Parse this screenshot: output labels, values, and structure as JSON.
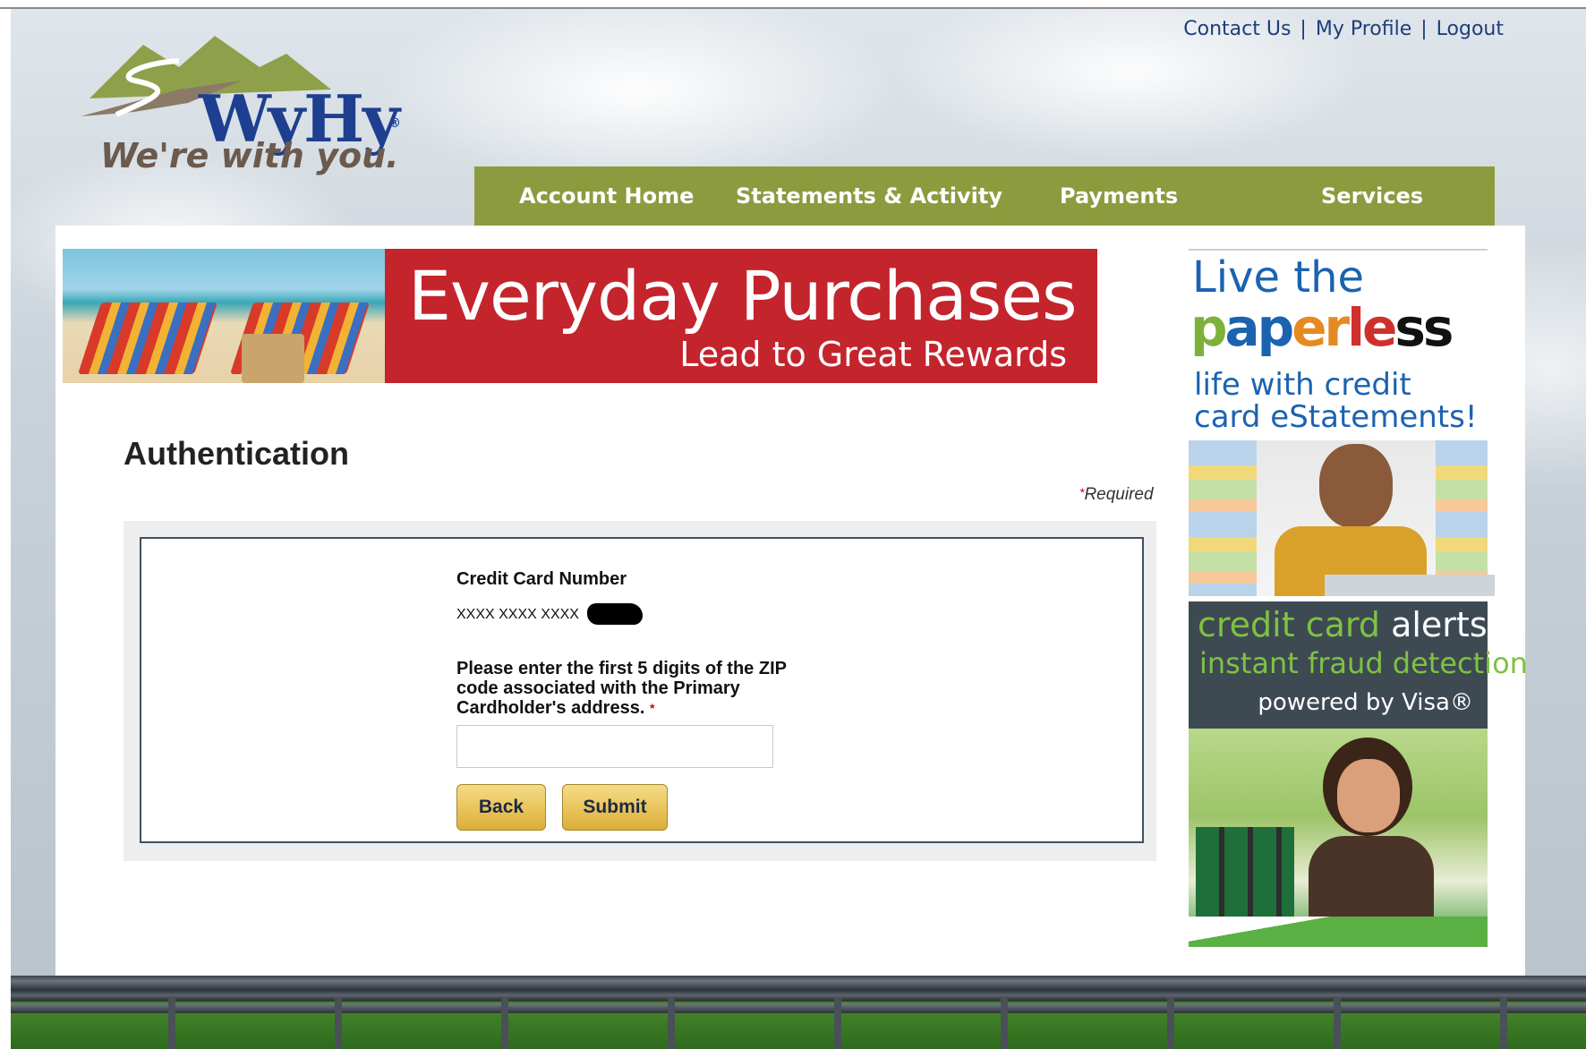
{
  "header": {
    "logo_name": "WyHy",
    "logo_tagline": "We're with you.",
    "util_links": [
      "Contact Us",
      "My Profile",
      "Logout"
    ],
    "separator": "|"
  },
  "nav": {
    "items": [
      "Account Home",
      "Statements & Activity",
      "Payments",
      "Services"
    ]
  },
  "banner": {
    "title": "Everyday Purchases",
    "subtitle": "Lead to Great Rewards"
  },
  "page": {
    "title": "Authentication",
    "required_star": "*",
    "required_label": "Required"
  },
  "form": {
    "card_label": "Credit Card Number",
    "card_masked": "XXXX XXXX XXXX",
    "zip_prompt": "Please enter the first 5 digits of the ZIP code associated with the Primary Cardholder's address.",
    "zip_required_star": "*",
    "zip_value": "",
    "zip_placeholder": "",
    "back_label": "Back",
    "submit_label": "Submit"
  },
  "sidebar": {
    "ad1": {
      "line1": "Live the",
      "paperless_parts": [
        "p",
        "ap",
        "er",
        "le",
        "ss"
      ],
      "line3a": "life with credit",
      "line3b": "card eStatements!"
    },
    "ad2": {
      "line1_green": "credit card",
      "line1_white": "alerts",
      "line2": "instant fraud detection",
      "line3": "powered by Visa®"
    }
  },
  "colors": {
    "nav_bg": "#8d9b3f",
    "banner_red": "#c4242c",
    "link_blue": "#1d3e7a",
    "button_gold": "#e9c35a",
    "required_red": "#d0021b"
  }
}
